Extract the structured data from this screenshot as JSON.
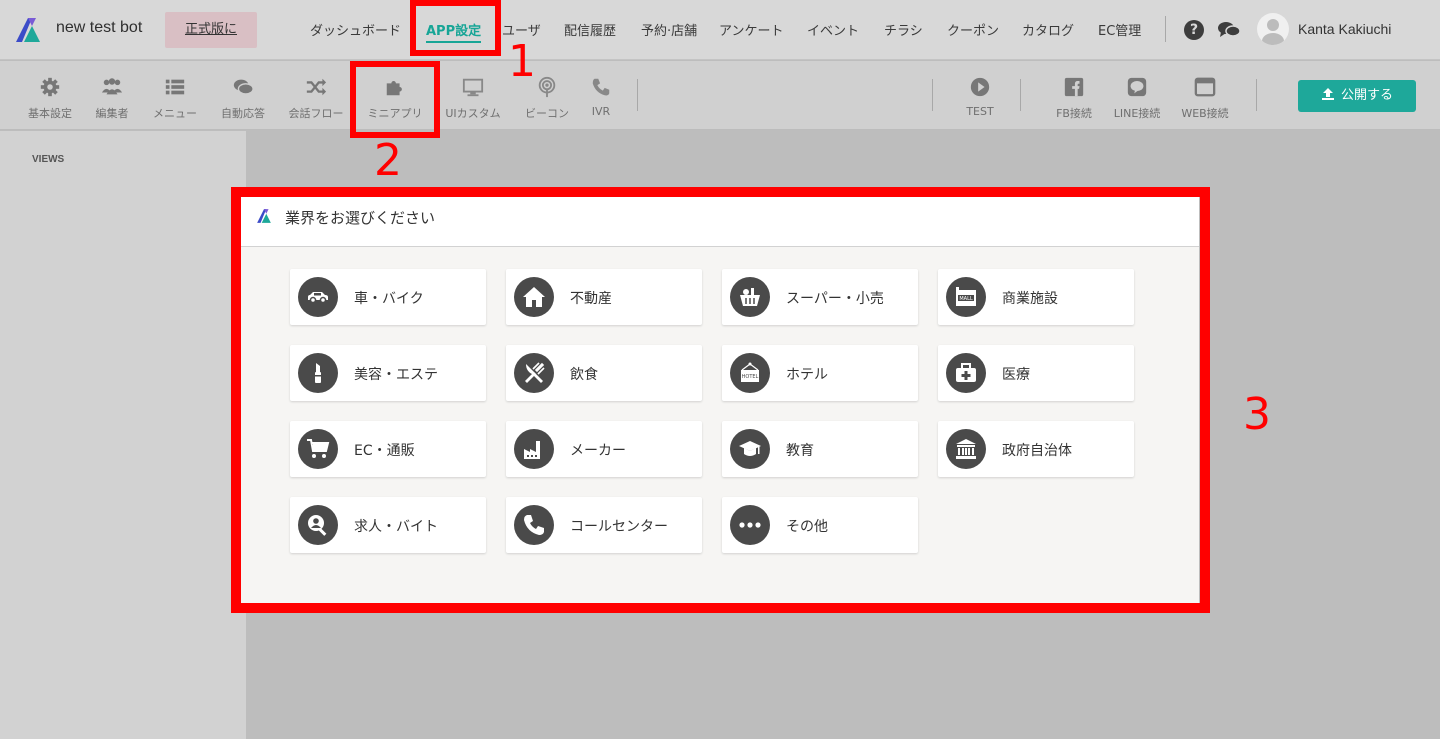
{
  "app": {
    "brand": "new test bot",
    "upgrade_label": "正式版に"
  },
  "topnav": {
    "items": [
      "ダッシュボード",
      "APP設定",
      "ユーザ",
      "配信履歴",
      "予約·店舗",
      "アンケート",
      "イベント",
      "チラシ",
      "クーポン",
      "カタログ",
      "EC管理"
    ],
    "active_index": 1,
    "help_icon": "question-circle-icon",
    "chat_icon": "chat-bubbles-icon",
    "user_name": "Kanta Kakiuchi"
  },
  "toolbar": {
    "items": [
      {
        "label": "基本設定",
        "icon": "gear-icon"
      },
      {
        "label": "編集者",
        "icon": "users-icon"
      },
      {
        "label": "メニュー",
        "icon": "list-icon"
      },
      {
        "label": "自動応答",
        "icon": "chat-icon"
      },
      {
        "label": "会話フロー",
        "icon": "shuffle-icon"
      },
      {
        "label": "ミニアプリ",
        "icon": "puzzle-icon"
      },
      {
        "label": "UIカスタム",
        "icon": "monitor-icon"
      },
      {
        "label": "ビーコン",
        "icon": "beacon-icon"
      },
      {
        "label": "IVR",
        "icon": "phone-icon"
      }
    ],
    "right_items": [
      {
        "label": "TEST",
        "icon": "play-icon"
      },
      {
        "label": "FB接続",
        "icon": "facebook-icon"
      },
      {
        "label": "LINE接続",
        "icon": "line-icon"
      },
      {
        "label": "WEB接続",
        "icon": "browser-window-icon"
      }
    ],
    "publish_label": "公開する"
  },
  "sidebar": {
    "views_label": "VIEWS"
  },
  "modal": {
    "title": "業界をお選びください",
    "categories": [
      {
        "label": "車・バイク",
        "icon": "car-icon"
      },
      {
        "label": "不動産",
        "icon": "house-icon"
      },
      {
        "label": "スーパー・小売",
        "icon": "basket-icon"
      },
      {
        "label": "商業施設",
        "icon": "mall-icon"
      },
      {
        "label": "美容・エステ",
        "icon": "lipstick-icon"
      },
      {
        "label": "飲食",
        "icon": "fork-knife-icon"
      },
      {
        "label": "ホテル",
        "icon": "hotel-sign-icon"
      },
      {
        "label": "医療",
        "icon": "medical-kit-icon"
      },
      {
        "label": "EC・通販",
        "icon": "shopping-cart-icon"
      },
      {
        "label": "メーカー",
        "icon": "factory-icon"
      },
      {
        "label": "教育",
        "icon": "graduation-cap-icon"
      },
      {
        "label": "政府自治体",
        "icon": "government-building-icon"
      },
      {
        "label": "求人・バイト",
        "icon": "job-search-icon"
      },
      {
        "label": "コールセンター",
        "icon": "phone-icon"
      },
      {
        "label": "その他",
        "icon": "more-dots-icon"
      }
    ]
  },
  "annotations": {
    "numbers": [
      "1",
      "2",
      "3"
    ],
    "color": "#ff0000"
  },
  "colors": {
    "accent": "#17a596",
    "publish": "#1ea89a",
    "icon_circle": "#4a4a4a"
  }
}
